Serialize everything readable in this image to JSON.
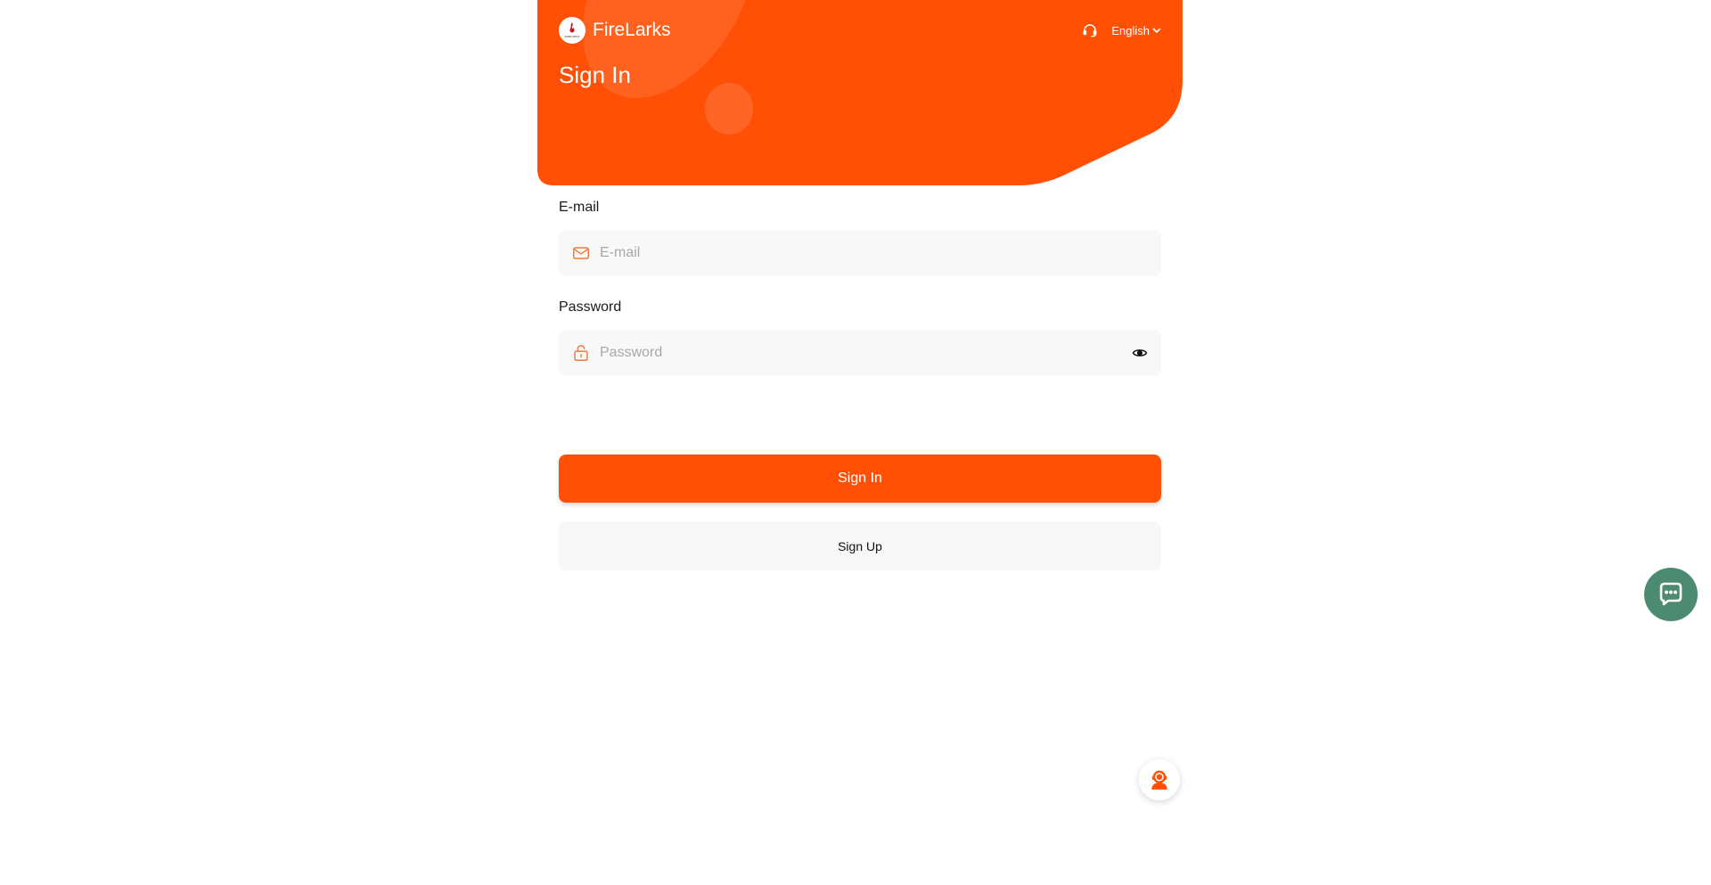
{
  "brand": {
    "name": "FireLarks",
    "logo_text": "FIRELARKS",
    "logo_icon": "flame-icon"
  },
  "header": {
    "title": "Sign In",
    "language": "English",
    "support_icon": "headset-icon"
  },
  "form": {
    "email": {
      "label": "E-mail",
      "placeholder": "E-mail",
      "value": "",
      "icon": "mail-icon"
    },
    "password": {
      "label": "Password",
      "placeholder": "Password",
      "value": "",
      "icon": "lock-icon",
      "toggle_icon": "eye-icon"
    }
  },
  "actions": {
    "sign_in": "Sign In",
    "sign_up": "Sign Up"
  },
  "floating": {
    "agent_icon": "customer-service-icon",
    "chat_icon": "chat-icon"
  },
  "colors": {
    "accent": "#ff5005",
    "input_bg": "#f8f8f8",
    "chat_bg": "#4c8a72"
  }
}
